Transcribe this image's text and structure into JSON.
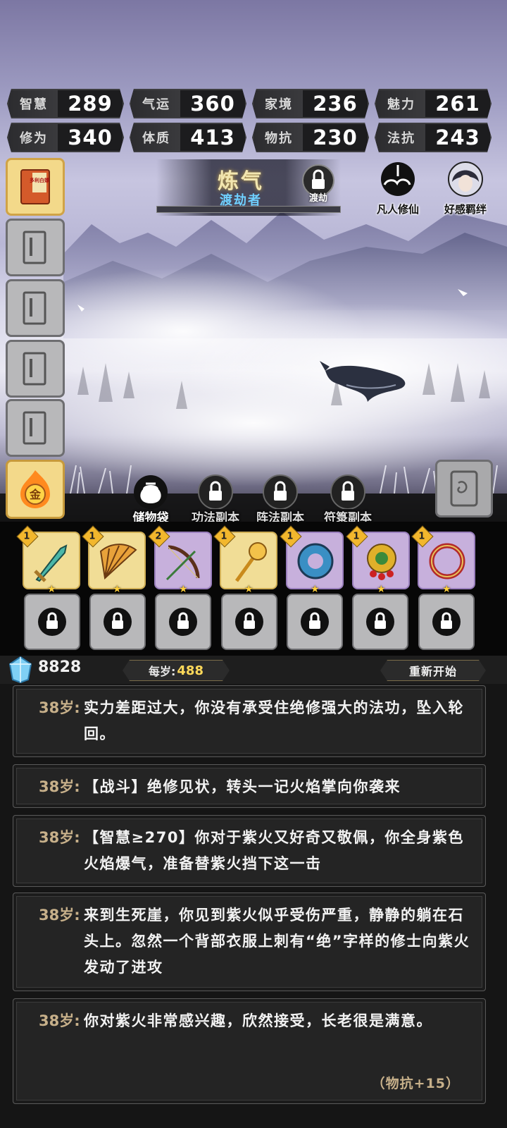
{
  "stats": [
    {
      "label": "智慧",
      "value": "289"
    },
    {
      "label": "气运",
      "value": "360"
    },
    {
      "label": "家境",
      "value": "236"
    },
    {
      "label": "魅力",
      "value": "261"
    },
    {
      "label": "修为",
      "value": "340"
    },
    {
      "label": "体质",
      "value": "413"
    },
    {
      "label": "物抗",
      "value": "230"
    },
    {
      "label": "法抗",
      "value": "243"
    }
  ],
  "realm": {
    "title": "炼气",
    "subtitle": "渡劫者",
    "badge_label": "渡劫",
    "progress": 0.0
  },
  "top_buttons": {
    "mortal": "凡人修仙",
    "bond": "好感羁绊"
  },
  "manual_book_label": "多利白嫖",
  "gold_label": "金",
  "dungeon_tabs": [
    {
      "label": "储物袋",
      "locked": false
    },
    {
      "label": "功法副本",
      "locked": true
    },
    {
      "label": "阵法副本",
      "locked": true
    },
    {
      "label": "符箓副本",
      "locked": true
    }
  ],
  "equipment": [
    {
      "name": "sword",
      "level": "1",
      "rarity": "gold",
      "stars": "★"
    },
    {
      "name": "fan",
      "level": "1",
      "rarity": "gold",
      "stars": "★"
    },
    {
      "name": "bow",
      "level": "2",
      "rarity": "purple",
      "stars": "★"
    },
    {
      "name": "golden-scepter",
      "level": "1",
      "rarity": "gold",
      "stars": "★"
    },
    {
      "name": "jade-ring",
      "level": "1",
      "rarity": "purple",
      "stars": "★"
    },
    {
      "name": "gold-amulet",
      "level": "1",
      "rarity": "purple",
      "stars": "★"
    },
    {
      "name": "red-ring",
      "level": "1",
      "rarity": "purple",
      "stars": "★"
    }
  ],
  "resources": {
    "gems": "8828",
    "per_age_label": "每岁:",
    "per_age_value": "488",
    "restart_label": "重新开始"
  },
  "log": [
    {
      "age": "38岁:",
      "text": "实力差距过大，你没有承受住绝修强大的法功，坠入轮回。",
      "extra": ""
    },
    {
      "age": "38岁:",
      "text": "【战斗】绝修见状，转头一记火焰掌向你袭来",
      "extra": ""
    },
    {
      "age": "38岁:",
      "text": "【智慧≥270】你对于紫火又好奇又敬佩，你全身紫色火焰爆气，准备替紫火挡下这一击",
      "extra": ""
    },
    {
      "age": "38岁:",
      "text": "来到生死崖，你见到紫火似乎受伤严重，静静的躺在石头上。忽然一个背部衣服上刺有“绝”字样的修士向紫火发动了进攻",
      "extra": ""
    },
    {
      "age": "38岁:",
      "text": "你对紫火非常感兴趣，欣然接受，长老很是满意。",
      "extra": "（物抗+15）"
    }
  ]
}
